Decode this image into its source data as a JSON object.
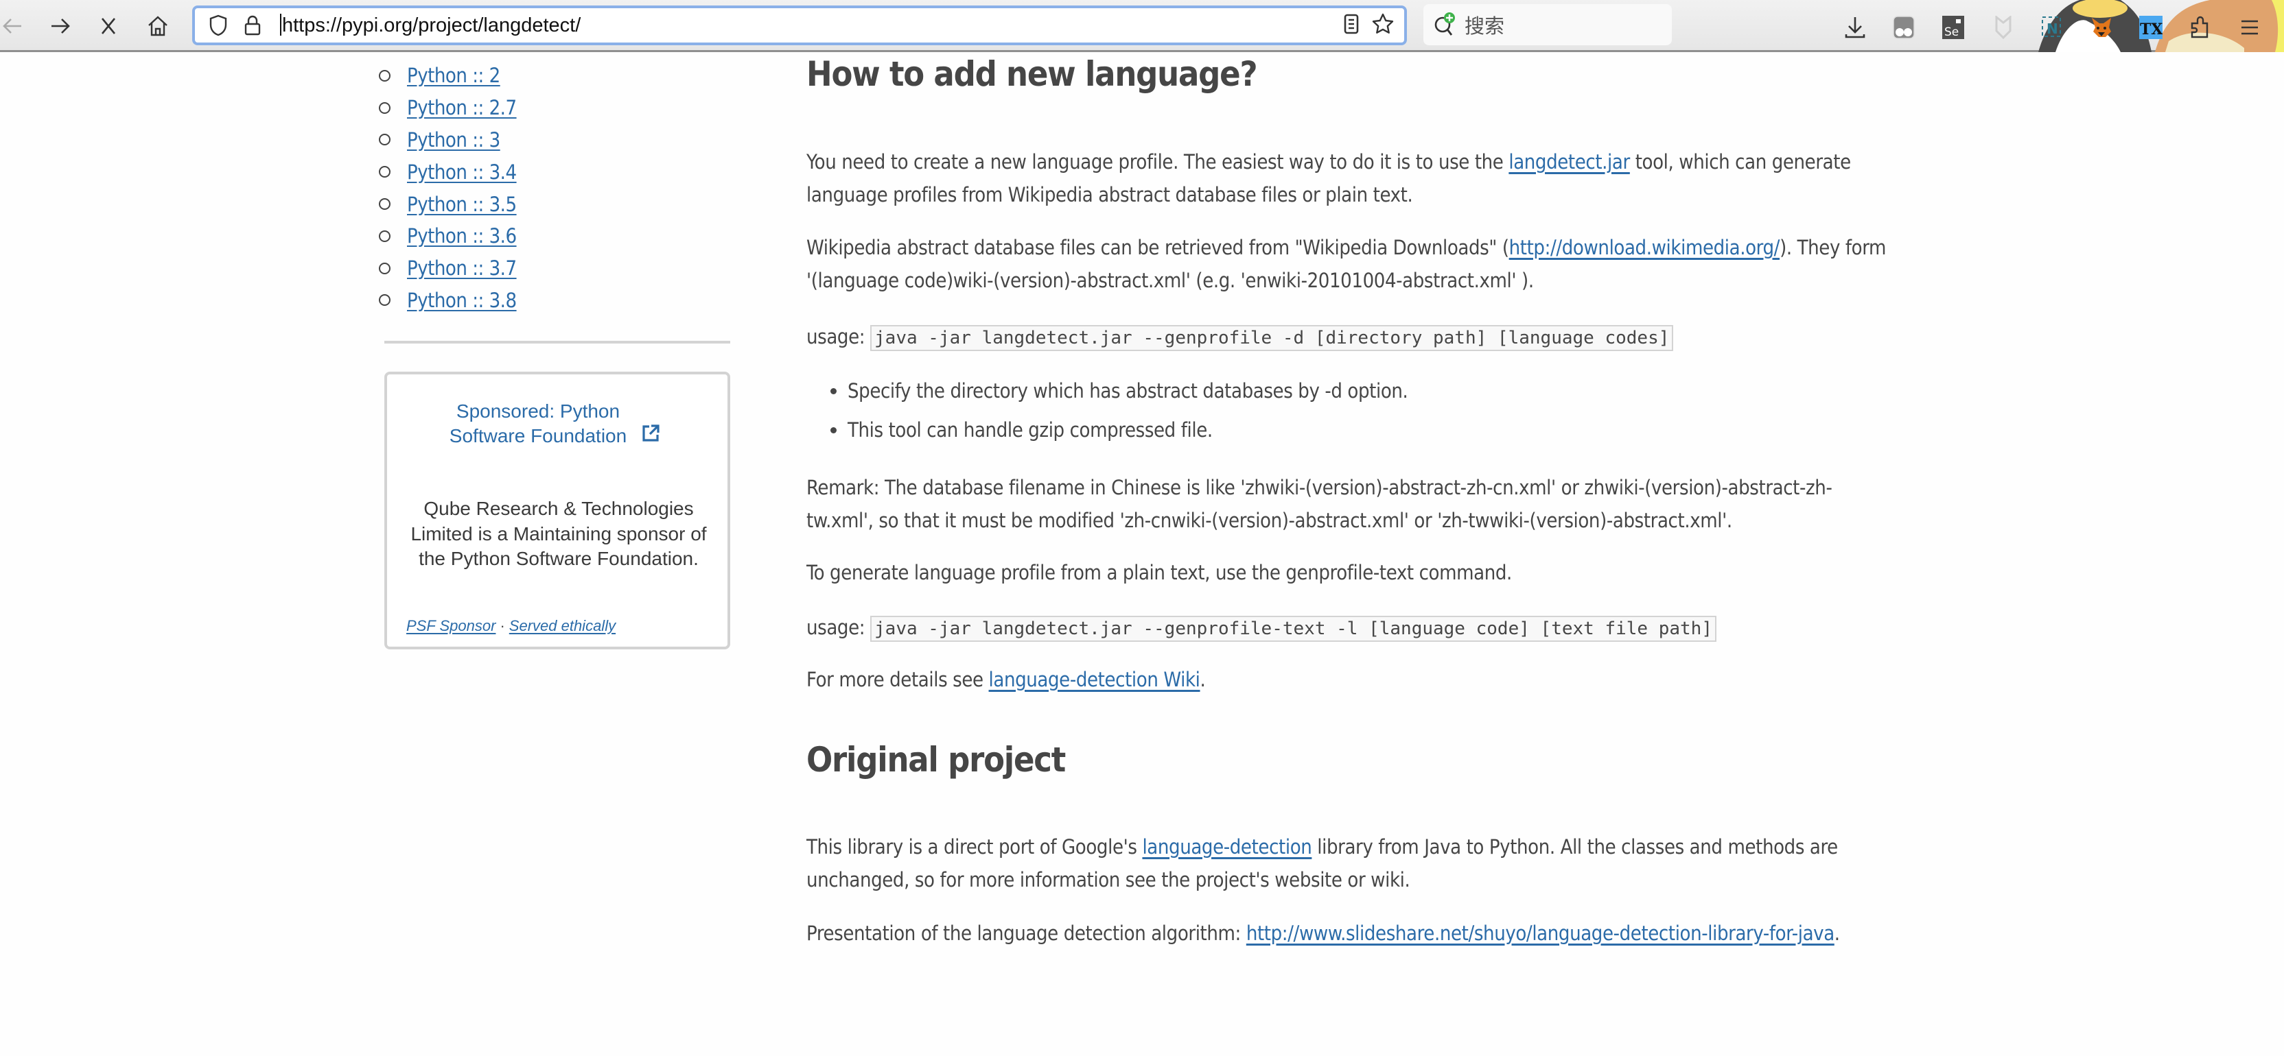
{
  "browser": {
    "url": "https://pypi.org/project/langdetect/",
    "search_placeholder": "搜索",
    "nav": {
      "back": "back-icon",
      "forward": "forward-icon",
      "stop": "stop-icon",
      "home": "home-icon"
    },
    "toolbar_icons": [
      "download-icon",
      "ghostery-extension-icon",
      "selenium-ide-extension-icon",
      "privacy-extension-icon",
      "nimbus-extension-icon",
      "metamask-extension-icon",
      "translate-tx-extension-icon",
      "extensions-icon",
      "menu-icon"
    ]
  },
  "sidebar": {
    "classifiers": [
      "Python :: 2",
      "Python :: 2.7",
      "Python :: 3",
      "Python :: 3.4",
      "Python :: 3.5",
      "Python :: 3.6",
      "Python :: 3.7",
      "Python :: 3.8"
    ],
    "sponsor": {
      "title": "Sponsored: Python Software Foundation",
      "description": "Qube Research & Technologies Limited is a Maintaining sponsor of the Python Software Foundation.",
      "footer_link_1": "PSF Sponsor",
      "separator": "·",
      "footer_link_2": "Served ethically"
    }
  },
  "main": {
    "section1": {
      "heading": "How to add new language?",
      "p1_before": "You need to create a new language profile. The easiest way to do it is to use the ",
      "p1_link": "langdetect.jar",
      "p1_after": " tool, which can generate language profiles from Wikipedia abstract database files or plain text.",
      "p2_before": "Wikipedia abstract database files can be retrieved from \"Wikipedia Downloads\" (",
      "p2_link": "http://download.wikimedia.org/",
      "p2_after": "). They form '(language code)wiki-(version)-abstract.xml' (e.g. 'enwiki-20101004-abstract.xml' ).",
      "usage_label": "usage: ",
      "usage1_code": "java -jar langdetect.jar --genprofile -d [directory path] [language codes]",
      "bullets": [
        "Specify the directory which has abstract databases by -d option.",
        "This tool can handle gzip compressed file."
      ],
      "remark": "Remark: The database filename in Chinese is like 'zhwiki-(version)-abstract-zh-cn.xml' or zhwiki-(version)-abstract-zh-tw.xml', so that it must be modified 'zh-cnwiki-(version)-abstract.xml' or 'zh-twwiki-(version)-abstract.xml'.",
      "p_plain": "To generate language profile from a plain text, use the genprofile-text command.",
      "usage2_code": "java -jar langdetect.jar --genprofile-text -l [language code] [text file path]",
      "more_before": "For more details see ",
      "more_link": "language-detection Wiki",
      "more_after": "."
    },
    "section2": {
      "heading": "Original project",
      "p1_before": "This library is a direct port of Google's ",
      "p1_link": "language-detection",
      "p1_after": " library from Java to Python. All the classes and methods are unchanged, so for more information see the project's website or wiki.",
      "p2_before": "Presentation of the language detection algorithm: ",
      "p2_link": "http://www.slideshare.net/shuyo/language-detection-library-for-java",
      "p2_after": "."
    }
  },
  "colors": {
    "link": "#2b6ba8",
    "text": "#464646",
    "url_focus_border": "#8ab0e8",
    "code_bg": "#f8f8f8",
    "border_gray": "#d3d3d3"
  }
}
